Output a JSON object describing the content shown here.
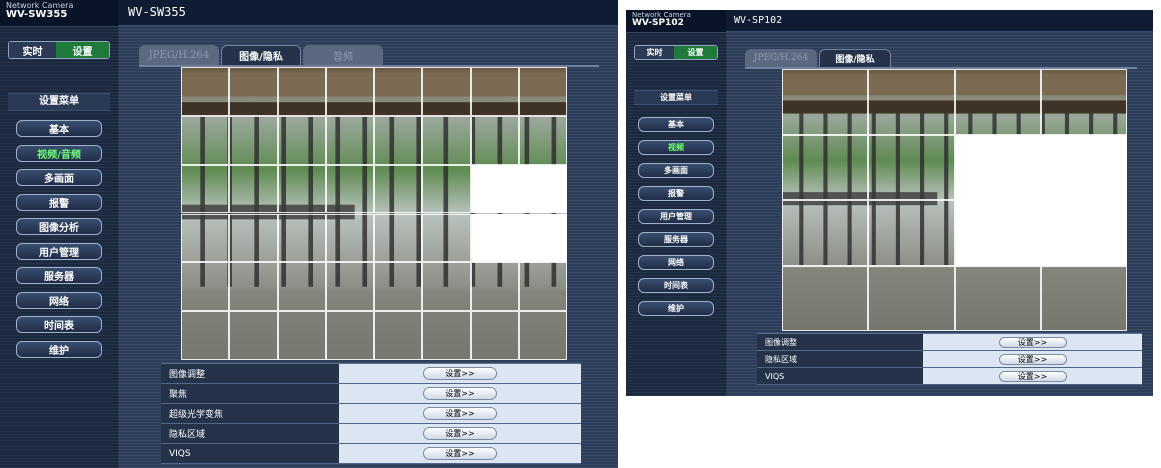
{
  "left": {
    "brand_line1": "Network Camera",
    "brand_line2": "WV-SW355",
    "model": "WV-SW355",
    "toggle_live": "实时",
    "toggle_setup": "设置",
    "menu_title": "设置菜单",
    "menu": [
      "基本",
      "视频/音频",
      "多画面",
      "报警",
      "图像分析",
      "用户管理",
      "服务器",
      "网络",
      "时间表",
      "维护"
    ],
    "active_menu": "视频/音频",
    "tabs": [
      "JPEG/H.264",
      "图像/隐私",
      "音频"
    ],
    "active_tab": "图像/隐私",
    "grid_cols": 8,
    "grid_rows": 6,
    "masked_cells": [
      "2-6",
      "2-7",
      "3-6",
      "3-7"
    ],
    "settings": [
      {
        "label": "图像调整",
        "button": "设置>>"
      },
      {
        "label": "聚焦",
        "button": "设置>>"
      },
      {
        "label": "超级光学变焦",
        "button": "设置>>"
      },
      {
        "label": "隐私区域",
        "button": "设置>>"
      },
      {
        "label": "VIQS",
        "button": "设置>>"
      }
    ]
  },
  "right": {
    "brand_line1": "Network Camera",
    "brand_line2": "WV-SP102",
    "model": "WV-SP102",
    "toggle_live": "实时",
    "toggle_setup": "设置",
    "menu_title": "设置菜单",
    "menu": [
      "基本",
      "视频",
      "多画面",
      "报警",
      "用户管理",
      "服务器",
      "网络",
      "时间表",
      "维护"
    ],
    "active_menu": "视频",
    "tabs": [
      "JPEG/H.264",
      "图像/隐私"
    ],
    "active_tab": "图像/隐私",
    "grid_cols": 4,
    "grid_rows": 4,
    "masked_cells": [
      "1-2",
      "1-3",
      "2-2",
      "2-3"
    ],
    "settings": [
      {
        "label": "图像调整",
        "button": "设置>>"
      },
      {
        "label": "隐私区域",
        "button": "设置>>"
      },
      {
        "label": "VIQS",
        "button": "设置>>"
      }
    ]
  },
  "colors": {
    "setup_active": "#1f7b3a",
    "menu_active_text": "#6dff74",
    "settings_value_bg": "#dce5f2",
    "panel_bg": "#24324a"
  }
}
